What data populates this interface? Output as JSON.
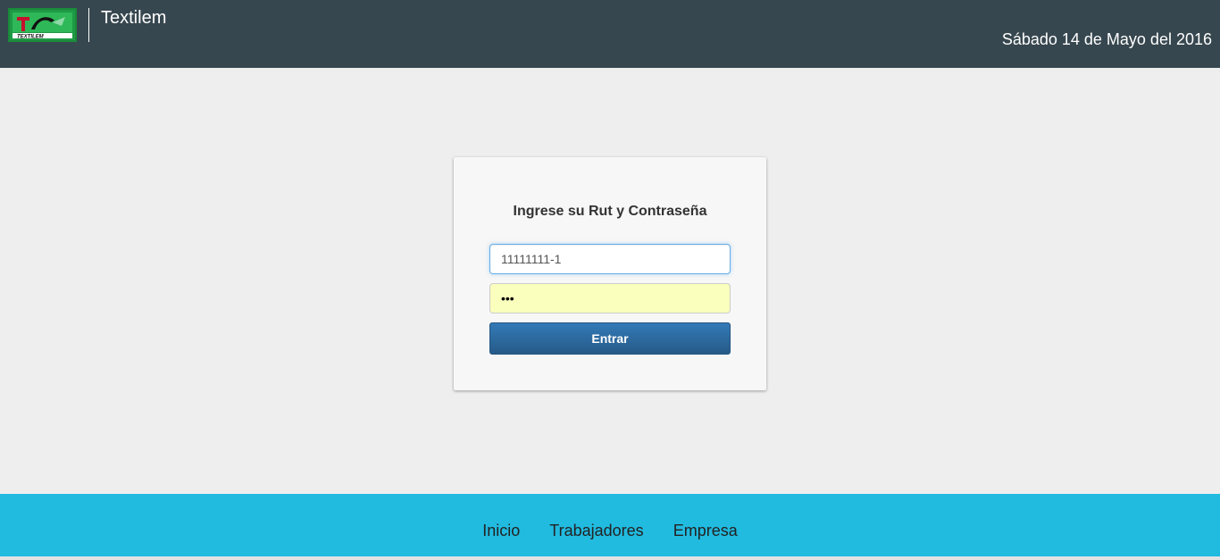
{
  "header": {
    "logo_text": "TEXTILEM",
    "app_title": "Textilem",
    "date": "Sábado 14 de Mayo del 2016"
  },
  "login": {
    "title": "Ingrese su Rut y Contraseña",
    "rut_value": "11111111-1",
    "password_value": "•••",
    "submit_label": "Entrar"
  },
  "footer": {
    "nav": [
      "Inicio",
      "Trabajadores",
      "Empresa"
    ]
  },
  "colors": {
    "header_bg": "#37474f",
    "page_bg": "#eeeeee",
    "footer_bg": "#21bbe0",
    "button_bg": "#2c6ea8",
    "logo_green": "#1a8a3a"
  }
}
